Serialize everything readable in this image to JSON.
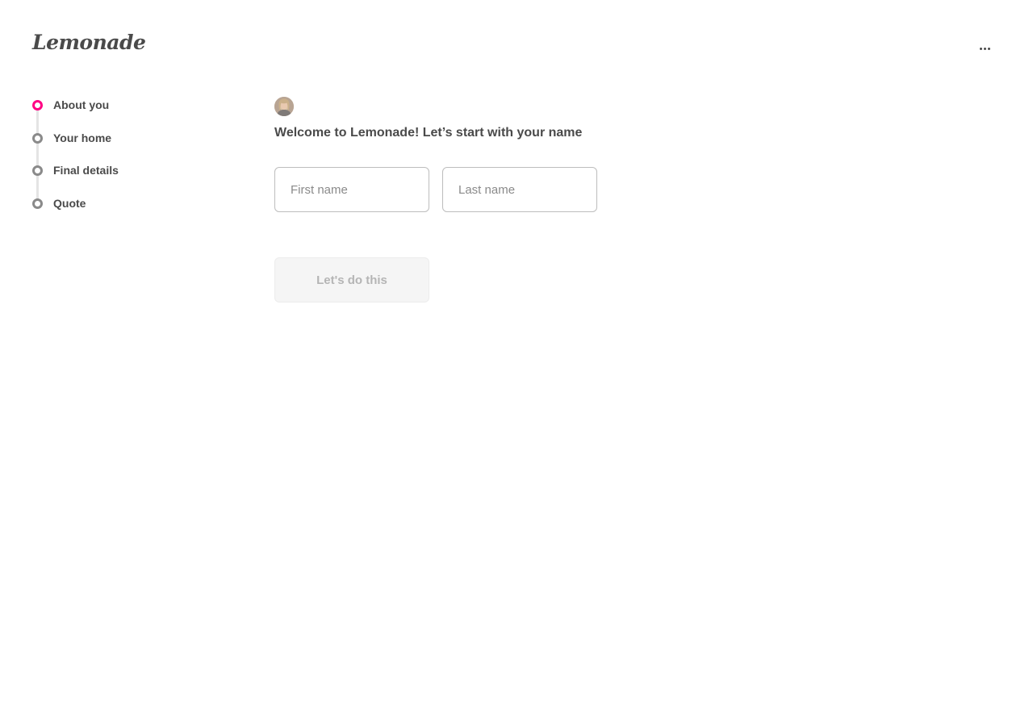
{
  "header": {
    "logo_text": "Lemonade",
    "more_icon": "ellipsis-icon"
  },
  "stepper": {
    "steps": [
      {
        "label": "About you",
        "state": "active"
      },
      {
        "label": "Your home",
        "state": "upcoming"
      },
      {
        "label": "Final details",
        "state": "upcoming"
      },
      {
        "label": "Quote",
        "state": "upcoming"
      }
    ]
  },
  "main": {
    "question": "Welcome to Lemonade! Let’s start with your name",
    "first_name": {
      "value": "",
      "placeholder": "First name"
    },
    "last_name": {
      "value": "",
      "placeholder": "Last name"
    },
    "submit_label": "Let's do this",
    "submit_enabled": false
  },
  "colors": {
    "accent": "#ff0083",
    "text": "#4a4a4a",
    "inactive_marker": "#8a8a8a",
    "disabled_button_bg": "#f5f5f5",
    "disabled_button_text": "#b5b5b5"
  }
}
